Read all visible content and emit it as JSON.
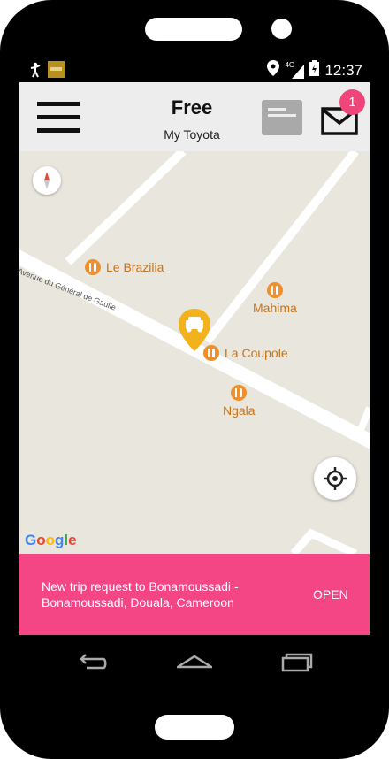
{
  "status_bar": {
    "network": "4G",
    "time": "12:37",
    "icons": [
      "stickman-notification-icon",
      "app-notification-icon",
      "location-icon",
      "signal-icon",
      "battery-icon"
    ]
  },
  "app_bar": {
    "title": "Free",
    "subtitle": "My Toyota",
    "icons": [
      "hamburger-menu-icon",
      "chat-icon",
      "mail-icon"
    ],
    "mail_badge": "1"
  },
  "map": {
    "street_label": "Avenue du Général de Gaulle",
    "pois": [
      {
        "name": "Le Brazilia"
      },
      {
        "name": "Mahima"
      },
      {
        "name": "La Coupole"
      },
      {
        "name": "Ngala"
      }
    ],
    "attribution": [
      "G",
      "o",
      "o",
      "g",
      "l",
      "e"
    ],
    "attribution_colors": [
      "#4285F4",
      "#EA4335",
      "#FBBC05",
      "#4285F4",
      "#34A853",
      "#EA4335"
    ],
    "marker_color": "#f2b21b"
  },
  "banner": {
    "message": "New trip request to Bonamoussadi - Bonamoussadi, Douala, Cameroon",
    "action": "OPEN",
    "color": "#f44585"
  },
  "nav_bar": {
    "icons": [
      "back-icon",
      "home-icon",
      "recents-icon"
    ]
  }
}
